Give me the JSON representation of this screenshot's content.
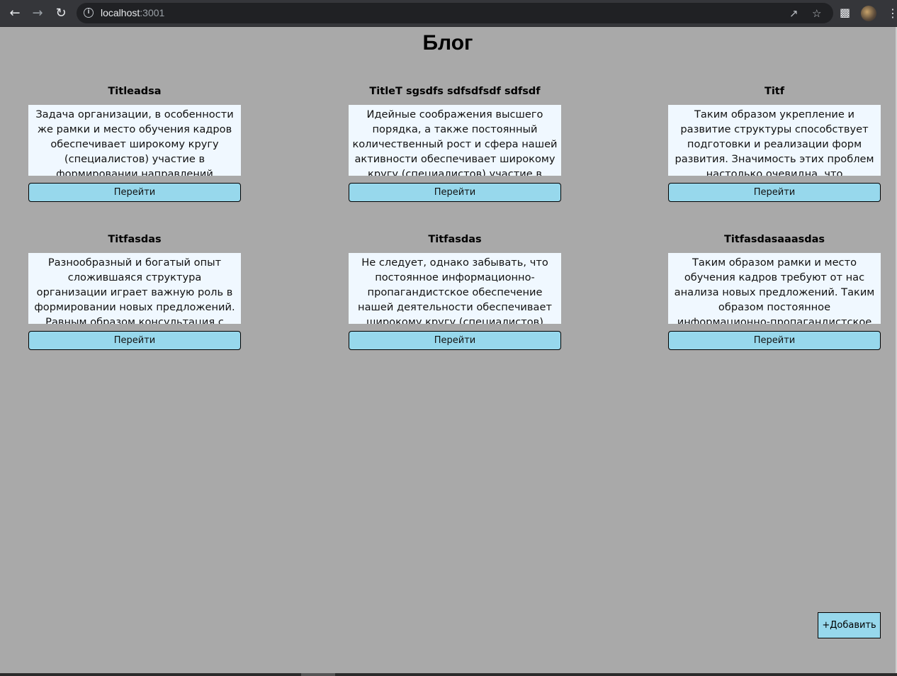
{
  "browser": {
    "url_host": "localhost",
    "url_port": ":3001",
    "icons": [
      "back-arrow-icon",
      "forward-arrow-icon",
      "reload-icon",
      "info-icon",
      "share-icon",
      "star-icon",
      "puzzle-icon",
      "avatar",
      "kebab-menu-icon"
    ]
  },
  "page": {
    "title": "Блог",
    "button_label": "Перейти",
    "add_label": "+Добавить"
  },
  "posts": [
    {
      "title": "Titleadsa",
      "body": "Задача организации, в особенности же рамки и место обучения кадров обеспечивает широкому кругу (специалистов) участие в формировании направлений"
    },
    {
      "title": "TitleT sgsdfs sdfsdfsdf sdfsdf",
      "body": "Идейные соображения высшего порядка, а также постоянный количественный рост и сфера нашей активности обеспечивает широкому кругу (специалистов) участие в"
    },
    {
      "title": "Titf",
      "body": "Таким образом укрепление и развитие структуры способствует подготовки и реализации форм развития. Значимость этих проблем настолько очевидна, что дальнейшее развитие"
    },
    {
      "title": "Titfasdas",
      "body": "Разнообразный и богатый опыт сложившаяся структура организации играет важную роль в формировании новых предложений. Равным образом консультация с широким активом"
    },
    {
      "title": "Titfasdas",
      "body": "Не следует, однако забывать, что постоянное информационно-пропагандистское обеспечение нашей деятельности обеспечивает широкому кругу (специалистов) участие в"
    },
    {
      "title": "Titfasdasaaasdas",
      "body": "Таким образом рамки и место обучения кадров требуют от нас анализа новых предложений. Таким образом постоянное информационно-пропагандистское обеспечение нашей"
    }
  ]
}
